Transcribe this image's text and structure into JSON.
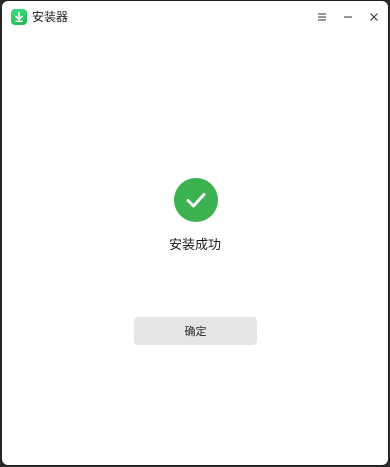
{
  "window": {
    "title": "安装器",
    "app_icon": "installer-download-icon",
    "controls": [
      "menu-icon",
      "minimize-icon",
      "close-icon"
    ]
  },
  "main": {
    "status_icon": "check-circle-icon",
    "status_text": "安装成功",
    "confirm_label": "确定"
  },
  "colors": {
    "accent_green": "#3bb24f",
    "button_bg": "#e5e5e5"
  }
}
